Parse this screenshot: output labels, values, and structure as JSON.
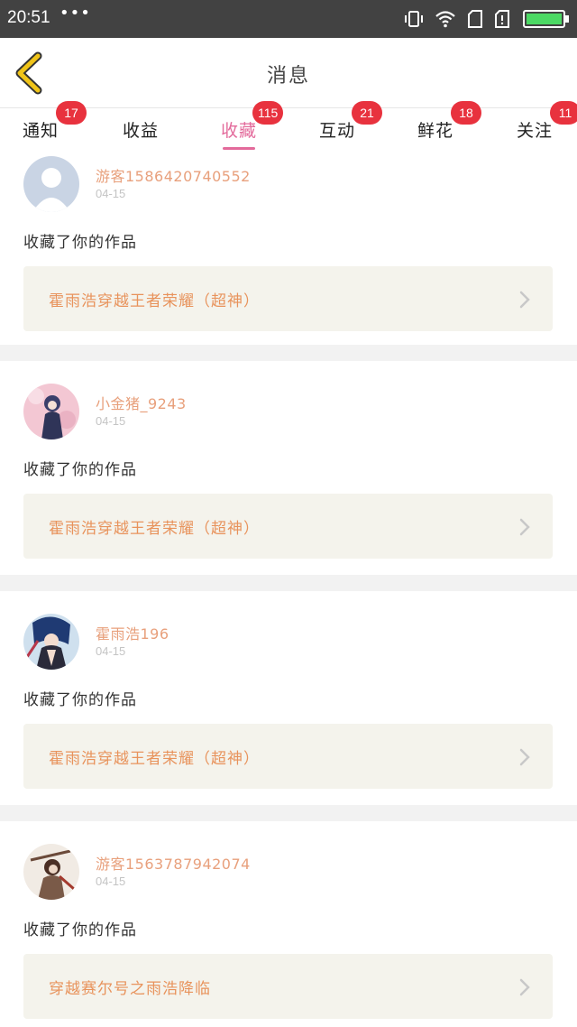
{
  "status_bar": {
    "time": "20:51",
    "dots": "•••",
    "battery_color": "#4cd964"
  },
  "header": {
    "title": "消息",
    "back_icon": "back-chevron-icon",
    "back_color": "#f0c419"
  },
  "tabs": [
    {
      "label": "通知",
      "badge": "17",
      "active": false
    },
    {
      "label": "收益",
      "badge": "",
      "active": false
    },
    {
      "label": "收藏",
      "badge": "115",
      "active": true
    },
    {
      "label": "互动",
      "badge": "21",
      "active": false
    },
    {
      "label": "鲜花",
      "badge": "18",
      "active": false
    },
    {
      "label": "关注",
      "badge": "11",
      "active": false
    }
  ],
  "colors": {
    "accent": "#e36a9b",
    "badge": "#e8323e",
    "username": "#e8a07c",
    "work_title": "#e8935c"
  },
  "messages": [
    {
      "username": "游客1586420740552",
      "date": "04-15",
      "action": "收藏了你的作品",
      "work": "霍雨浩穿越王者荣耀（超神）",
      "avatar": "default-avatar-icon"
    },
    {
      "username": "小金猪_9243",
      "date": "04-15",
      "action": "收藏了你的作品",
      "work": "霍雨浩穿越王者荣耀（超神）",
      "avatar": "anime-avatar-pink"
    },
    {
      "username": "霍雨浩196",
      "date": "04-15",
      "action": "收藏了你的作品",
      "work": "霍雨浩穿越王者荣耀（超神）",
      "avatar": "anime-avatar-blue"
    },
    {
      "username": "游客1563787942074",
      "date": "04-15",
      "action": "收藏了你的作品",
      "work": "穿越赛尔号之雨浩降临",
      "avatar": "anime-avatar-warrior"
    }
  ]
}
